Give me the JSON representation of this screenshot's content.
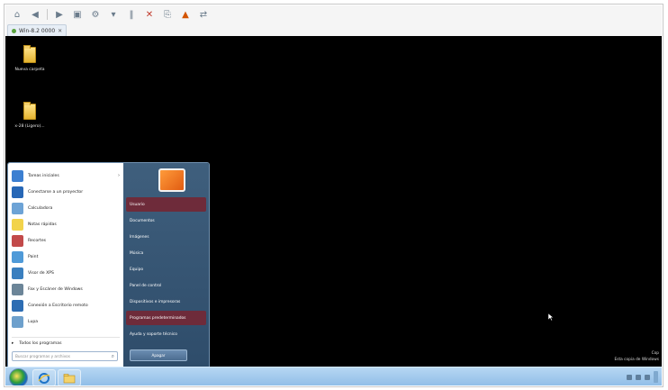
{
  "host": {
    "tab_label": "Win-8.2 0000",
    "toolbar_icons": [
      "home-icon",
      "back-icon",
      "forward-icon",
      "save-icon",
      "settings-icon",
      "dropdown-icon",
      "pause-icon",
      "stop-icon",
      "snapshot-icon",
      "alert-icon",
      "network-icon"
    ]
  },
  "desktop": {
    "icons": [
      {
        "label": "Nueva carpeta"
      },
      {
        "label": "x-28 (Ligero)..."
      }
    ]
  },
  "start_menu": {
    "left_items": [
      {
        "label": "Tareas iniciales",
        "icon_color": "#3c7fd1",
        "has_arrow": true
      },
      {
        "label": "Conectarse a un proyector",
        "icon_color": "#2767b6"
      },
      {
        "label": "Calculadora",
        "icon_color": "#6da3d6"
      },
      {
        "label": "Notas rápidas",
        "icon_color": "#f2d34b"
      },
      {
        "label": "Recortes",
        "icon_color": "#c24a4a"
      },
      {
        "label": "Paint",
        "icon_color": "#4f9ad8"
      },
      {
        "label": "Visor de XPS",
        "icon_color": "#3a7fbf"
      },
      {
        "label": "Fax y Escáner de Windows",
        "icon_color": "#6c8598"
      },
      {
        "label": "Conexión a Escritorio remoto",
        "icon_color": "#2d6db3"
      },
      {
        "label": "Lupa",
        "icon_color": "#6ea0cc"
      }
    ],
    "all_programs": "Todos los programas",
    "search_placeholder": "Buscar programas y archivos",
    "right_items": [
      {
        "label": "Usuario",
        "highlight": true
      },
      {
        "label": "Documentos"
      },
      {
        "label": "Imágenes"
      },
      {
        "label": "Música"
      },
      {
        "label": "Equipo"
      },
      {
        "label": "Panel de control"
      },
      {
        "label": "Dispositivos e impresoras"
      },
      {
        "label": "Programas predeterminados",
        "highlight": true
      },
      {
        "label": "Ayuda y soporte técnico"
      }
    ],
    "shutdown_label": "Apagar"
  },
  "watermark": {
    "line1": "Cop",
    "line2": "Esta copia de Windows"
  },
  "taskbar": {
    "apps": [
      "ie-icon",
      "explorer-icon"
    ]
  }
}
